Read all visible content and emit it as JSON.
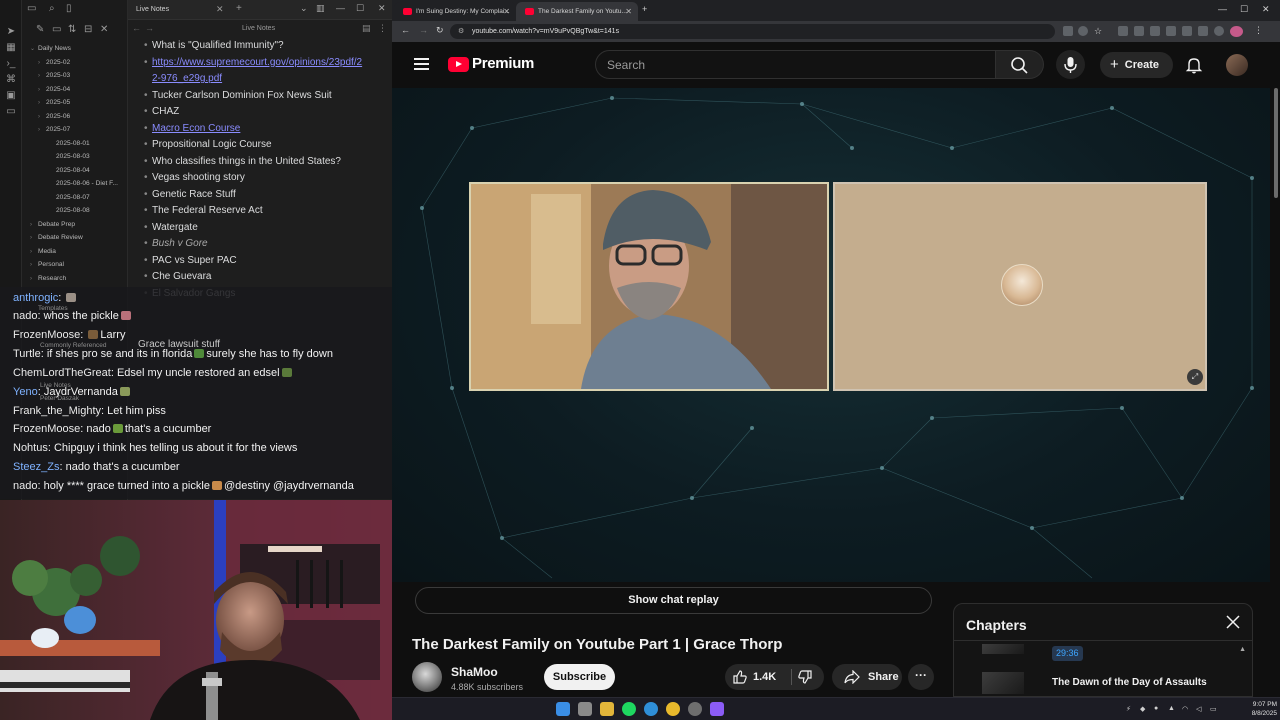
{
  "obsidian": {
    "tab_title": "Live Notes",
    "nav_title": "Live Notes",
    "tree": [
      {
        "label": "Daily News",
        "level": 0,
        "open": true
      },
      {
        "label": "2025-02",
        "level": 1
      },
      {
        "label": "2025-03",
        "level": 1
      },
      {
        "label": "2025-04",
        "level": 1
      },
      {
        "label": "2025-05",
        "level": 1
      },
      {
        "label": "2025-06",
        "level": 1
      },
      {
        "label": "2025-07",
        "level": 1
      },
      {
        "label": "2025-08-01",
        "level": 2
      },
      {
        "label": "2025-08-03",
        "level": 2
      },
      {
        "label": "2025-08-04",
        "level": 2
      },
      {
        "label": "2025-08-06 - Diet F...",
        "level": 2
      },
      {
        "label": "2025-08-07",
        "level": 2
      },
      {
        "label": "2025-08-08",
        "level": 2
      },
      {
        "label": "Debate Prep",
        "level": 0
      },
      {
        "label": "Debate Review",
        "level": 0
      },
      {
        "label": "Media",
        "level": 0
      },
      {
        "label": "Personal",
        "level": 0
      },
      {
        "label": "Research",
        "level": 0
      }
    ],
    "notes": [
      {
        "text": "What is \"Qualified Immunity\"?",
        "style": "normal"
      },
      {
        "text": "https://www.supremecourt.gov/opinions/23pdf/2",
        "style": "link"
      },
      {
        "text": "2-976_e29g.pdf",
        "style": "link-cont"
      },
      {
        "text": "Tucker Carlson Dominion Fox News Suit",
        "style": "normal"
      },
      {
        "text": "CHAZ",
        "style": "normal"
      },
      {
        "text": "Macro Econ Course",
        "style": "link"
      },
      {
        "text": "Propositional Logic Course",
        "style": "normal"
      },
      {
        "text": "Who classifies things in the United States?",
        "style": "normal"
      },
      {
        "text": "Vegas shooting story",
        "style": "normal"
      },
      {
        "text": "Genetic Race Stuff",
        "style": "normal"
      },
      {
        "text": "The Federal Reserve Act",
        "style": "normal"
      },
      {
        "text": "Watergate",
        "style": "normal"
      },
      {
        "text": "Bush v Gore",
        "style": "italic"
      },
      {
        "text": "PAC vs Super PAC",
        "style": "normal"
      },
      {
        "text": "Che Guevara",
        "style": "normal"
      },
      {
        "text": "El Salvador Gangs",
        "style": "normal"
      }
    ],
    "ghost_items": [
      "Templates",
      "Commonly Referenced",
      "Live Notes",
      "Peter Daszak"
    ],
    "ghost_note": "Grace lawsuit stuff"
  },
  "chat": [
    {
      "user": "anthrogic",
      "msg": "",
      "user_color": "blue",
      "emote": "#9a8f86"
    },
    {
      "user": "nado",
      "msg": "whos the pickle",
      "user_color": "white",
      "emote_after": "#b9707a"
    },
    {
      "user": "FrozenMoose",
      "msg": "Larry",
      "user_color": "white",
      "emote": "#7a5c3a"
    },
    {
      "user": "Turtle",
      "msg": "if shes pro se and its in florida",
      "msg2": "surely she has to fly down",
      "user_color": "white",
      "emote_mid": "#4f8a3a"
    },
    {
      "user": "ChemLordTheGreat",
      "msg": "Edsel my uncle restored an edsel",
      "user_color": "white",
      "emote_after": "#5a7a3a"
    },
    {
      "user": "Yeno",
      "msg": "JaydrVernanda",
      "user_color": "blue",
      "emote_after": "#8a9a5a"
    },
    {
      "user": "Frank_the_Mighty",
      "msg": "Let him piss",
      "user_color": "white"
    },
    {
      "user": "FrozenMoose",
      "msg": "nado",
      "msg2": "that's a cucumber",
      "user_color": "white",
      "emote_mid": "#6a9a3a"
    },
    {
      "user": "Nohtus",
      "msg": "Chipguy i think hes telling us about it for the views",
      "user_color": "white"
    },
    {
      "user": "Steez_Zs",
      "msg": "nado that's a cucumber",
      "user_color": "blue"
    },
    {
      "user": "nado",
      "msg": "holy **** grace turned into a pickle",
      "msg2": "@destiny @jaydrvernanda",
      "user_color": "white",
      "emote_mid": "#c88a4a"
    }
  ],
  "browser": {
    "tabs": [
      {
        "label": "I'm Suing Destiny: My Complai...",
        "active": false
      },
      {
        "label": "The Darkest Family on Youtu...",
        "active": true
      }
    ],
    "url": "youtube.com/watch?v=mV9uPvQBgTw&t=141s"
  },
  "youtube": {
    "logo_text": "Premium",
    "search_placeholder": "Search",
    "create_label": "Create",
    "show_chat_replay": "Show chat replay",
    "video_title": "The Darkest Family on Youtube Part 1 | Grace Thorp",
    "channel_name": "ShaMoo",
    "subscribers": "4.88K subscribers",
    "subscribe_label": "Subscribe",
    "likes": "1.4K",
    "share_label": "Share",
    "more_label": "···",
    "chapters": {
      "title": "Chapters",
      "timestamp": "29:36",
      "chapter_title": "The Dawn of the Day of Assaults"
    }
  },
  "taskbar": {
    "time": "9:07 PM",
    "date": "8/8/2025"
  },
  "colors": {
    "yt_red": "#ff0033",
    "obsidian_link": "#8a8cff",
    "chat_blue_user": "#7fb2ff",
    "chapter_ts": "#3ea6ff"
  }
}
